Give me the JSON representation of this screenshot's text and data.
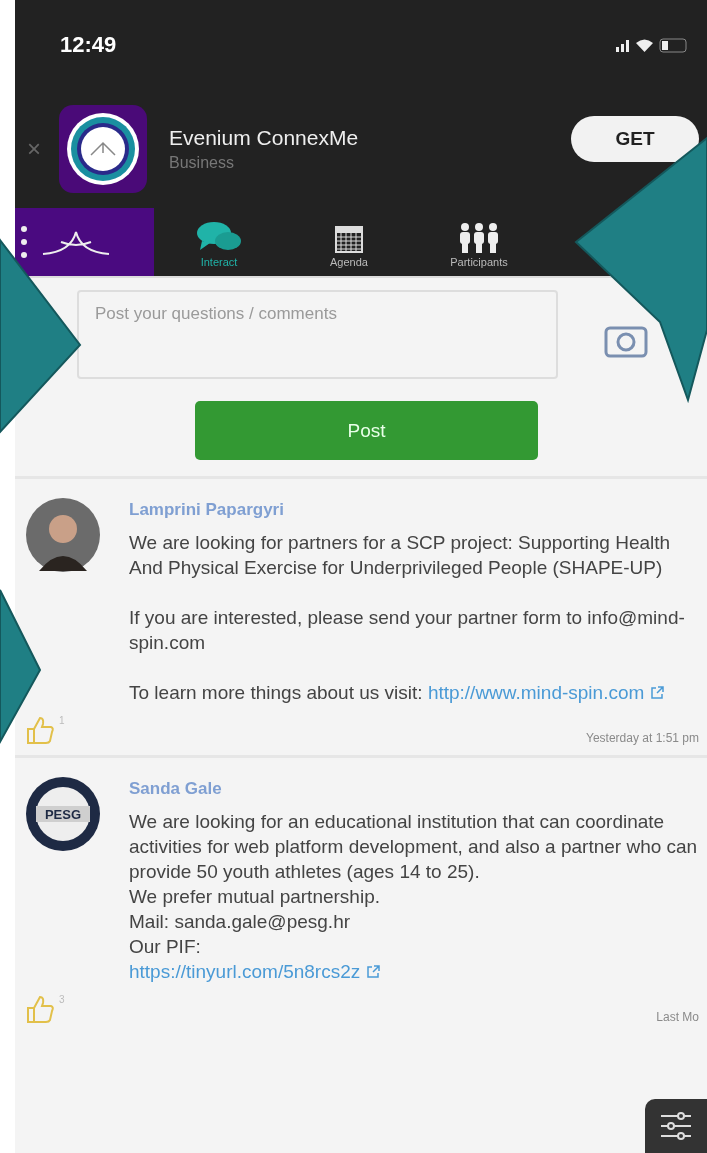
{
  "status_bar": {
    "time": "12:49"
  },
  "app_banner": {
    "close": "×",
    "name": "Evenium ConnexMe",
    "category": "Business",
    "button": "GET"
  },
  "tabs": [
    {
      "label": "Interact",
      "kind": "chat",
      "selected": true
    },
    {
      "label": "Agenda",
      "kind": "calendar",
      "selected": false
    },
    {
      "label": "Participants",
      "kind": "people",
      "selected": false
    }
  ],
  "composer": {
    "placeholder": "Post your questions / comments",
    "button": "Post"
  },
  "posts": [
    {
      "author": "Lamprini Papargyri",
      "kind": "photo",
      "paragraphs": [
        [
          {
            "kind": "text",
            "text": "We are looking for partners for a SCP project: Supporting Health And Physical Exercise for Underprivileged People (SHAPE-UP)"
          }
        ],
        [
          {
            "kind": "text",
            "text": "If you are interested, please send your partner form to info@mind-spin.com"
          }
        ],
        [
          {
            "kind": "text",
            "text": "To learn more things about us visit:",
            "link": "http://www.mind-spin.com"
          }
        ]
      ],
      "likes": "1",
      "time": "Yesterday at 1:51 pm"
    },
    {
      "author": "Sanda Gale",
      "kind": "badge",
      "badge_text": "PESG",
      "paragraphs": [
        [
          {
            "kind": "text",
            "text": "We are looking for an educational institution that can coordinate activities for web platform development, and also a partner who can provide 50 youth athletes (ages 14 to 25)."
          },
          {
            "kind": "text",
            "text": "We prefer mutual partnership."
          },
          {
            "kind": "text",
            "text": "Mail: sanda.gale@pesg.hr"
          },
          {
            "kind": "text",
            "text": "Our PIF:"
          },
          {
            "kind": "link",
            "text": "https://tinyurl.com/5n8rcs2z"
          }
        ]
      ],
      "likes": "3",
      "time": "Last Mo"
    }
  ]
}
